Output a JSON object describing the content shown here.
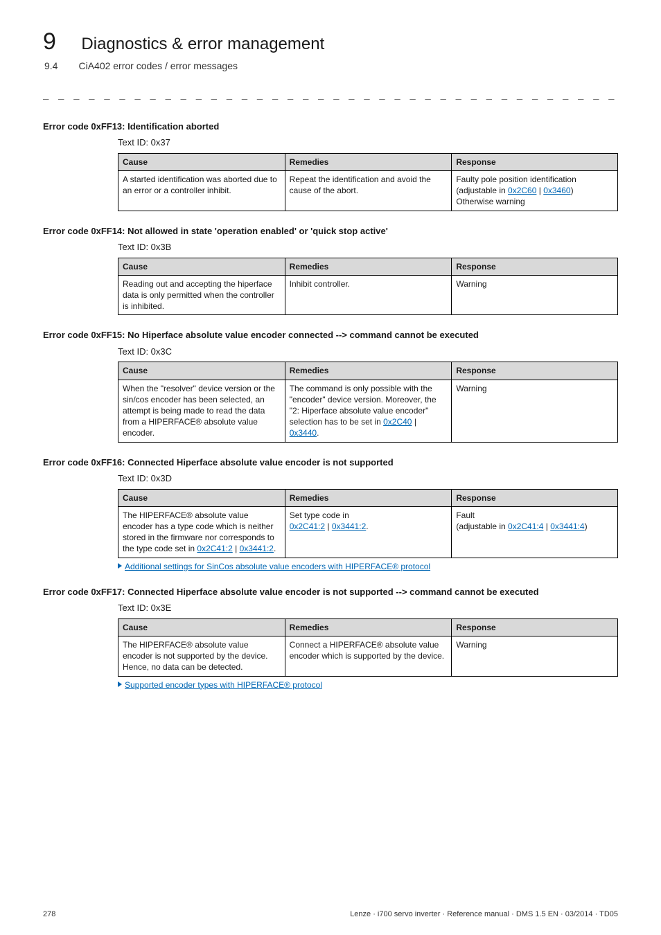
{
  "header": {
    "chapter_num": "9",
    "chapter_title": "Diagnostics & error management",
    "section_num": "9.4",
    "section_title": "CiA402 error codes / error messages",
    "dashline": "_ _ _ _ _ _ _ _ _ _ _ _ _ _ _ _ _ _ _ _ _ _ _ _ _ _ _ _ _ _ _ _ _ _ _ _ _ _ _ _ _ _ _ _ _ _ _ _ _ _ _ _ _ _ _ _ _ _ _ _ _ _ _ _"
  },
  "table_headers": {
    "cause": "Cause",
    "remedies": "Remedies",
    "response": "Response"
  },
  "blocks": {
    "b1": {
      "heading": "Error code 0xFF13: Identification aborted",
      "text_id": "Text ID: 0x37",
      "cause": "A started identification was aborted due to an error or a controller inhibit.",
      "remedies": "Repeat the identification and avoid the cause of the abort.",
      "response_pre": "Faulty pole position identification (adjustable in ",
      "response_link1": "0x2C60",
      "response_sep": " | ",
      "response_link2": "0x3460",
      "response_post": ")\nOtherwise warning"
    },
    "b2": {
      "heading": "Error code 0xFF14: Not allowed in state 'operation enabled' or 'quick stop active'",
      "text_id": "Text ID: 0x3B",
      "cause": "Reading out and accepting the hiperface data is only permitted when the controller is inhibited.",
      "remedies": "Inhibit controller.",
      "response": "Warning"
    },
    "b3": {
      "heading": "Error code 0xFF15: No Hiperface absolute value encoder connected --> command cannot be executed",
      "text_id": "Text ID: 0x3C",
      "cause": "When the \"resolver\" device version or the sin/cos encoder has been selected, an attempt is being made to read the data from a HIPERFACE® absolute value encoder.",
      "remedies_pre": "The command is only possible with the \"encoder\" device version. Moreover, the \"2: Hiperface absolute value encoder\" selection has to be set in ",
      "remedies_link1": "0x2C40",
      "remedies_sep": " | ",
      "remedies_link2": "0x3440",
      "remedies_post": ".",
      "response": "Warning"
    },
    "b4": {
      "heading": "Error code 0xFF16: Connected Hiperface absolute value encoder is not supported",
      "text_id": "Text ID: 0x3D",
      "cause_pre": "The HIPERFACE® absolute value encoder has a type code which is neither stored in the firmware nor corresponds to the type code set in ",
      "cause_link1": "0x2C41:2",
      "cause_sep": " | ",
      "cause_link2": "0x3441:2",
      "cause_post": ".",
      "remedies_pre": "Set type code in\n",
      "remedies_link1": "0x2C41:2",
      "remedies_sep": " | ",
      "remedies_link2": "0x3441:2",
      "remedies_post": ".",
      "response_pre": "Fault\n(adjustable in ",
      "response_link1": "0x2C41:4",
      "response_sep": " | ",
      "response_link2": "0x3441:4",
      "response_post": ")",
      "after_link": "Additional settings for SinCos absolute value encoders with HIPERFACE® protocol"
    },
    "b5": {
      "heading": "Error code 0xFF17: Connected Hiperface absolute value encoder is not supported --> command cannot be executed",
      "text_id": "Text ID: 0x3E",
      "cause": "The HIPERFACE® absolute value encoder is not supported by the device. Hence, no data can be detected.",
      "remedies": "Connect a HIPERFACE® absolute value encoder which is supported by the device.",
      "response": "Warning",
      "after_link": "Supported encoder types with HIPERFACE® protocol"
    }
  },
  "footer": {
    "page_num": "278",
    "doc": "Lenze · i700 servo inverter · Reference manual · DMS 1.5 EN · 03/2014 · TD05"
  }
}
